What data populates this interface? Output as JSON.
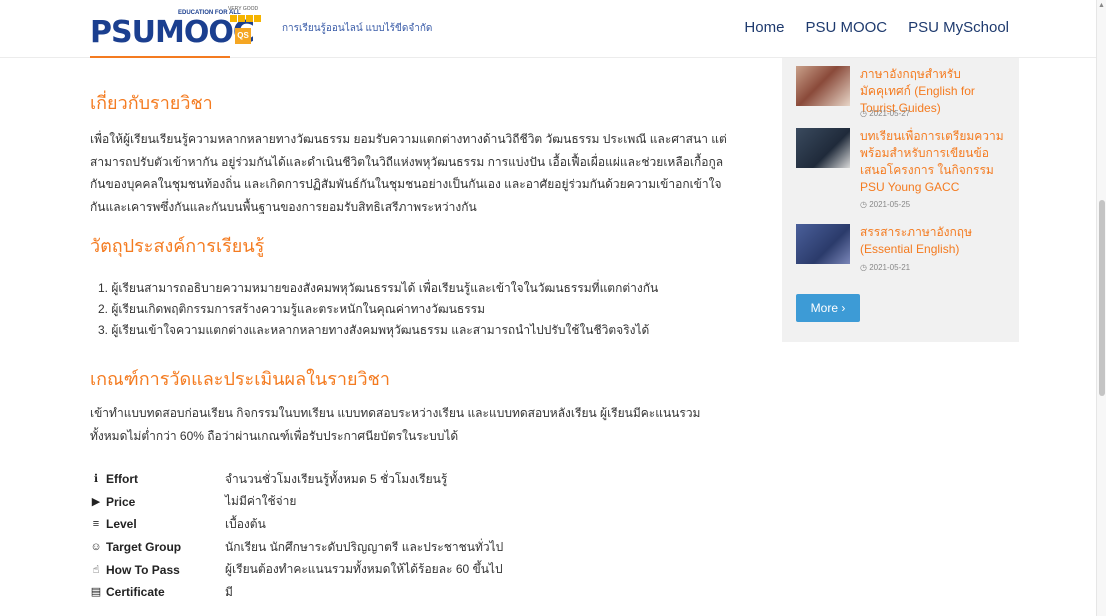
{
  "header": {
    "logo_text_psu": "PSU",
    "logo_text_mooc": "MOOC",
    "logo_tagline_small": "EDUCATION FOR ALL",
    "logo_badge_small": "VERY GOOD",
    "qs_badge": "QS",
    "tagline": "การเรียนรู้ออนไลน์ แบบไร้ขีดจำกัด",
    "nav": [
      {
        "label": "Home"
      },
      {
        "label": "PSU MOOC"
      },
      {
        "label": "PSU MySchool"
      }
    ]
  },
  "about": {
    "title": "เกี่ยวกับรายวิชา",
    "lines": [
      "เพื่อให้ผู้เรียนเรียนรู้ความหลากหลายทางวัฒนธรรม  ยอมรับความแตกต่างทางด้านวิถีชีวิต วัฒนธรรม ประเพณี และศาสนา แต่",
      "สามารถปรับตัวเข้าหากัน อยู่ร่วมกันได้และดำเนินชีวิตในวิถีแห่งพหุวัฒนธรรม การแบ่งปัน เอื้อเฟื้อเผื่อแผ่และช่วยเหลือเกื้อกูล",
      "กันของบุคคลในชุมชนท้องถิ่น และเกิดการปฏิสัมพันธ์กันในชุมชนอย่างเป็นกันเอง และอาศัยอยู่ร่วมกันด้วยความเข้าอกเข้าใจ",
      "กันและเคารพซึ่งกันและกันบนพื้นฐานของการยอมรับสิทธิเสรีภาพระหว่างกัน"
    ]
  },
  "objectives": {
    "title": "วัตถุประสงค์การเรียนรู้",
    "items": [
      "1. ผู้เรียนสามารถอธิบายความหมายของสังคมพหุวัฒนธรรมได้ เพื่อเรียนรู้และเข้าใจในวัฒนธรรมที่แตกต่างกัน",
      "2. ผู้เรียนเกิดพฤติกรรมการสร้างความรู้และตระหนักในคุณค่าทางวัฒนธรรม",
      "3. ผู้เรียนเข้าใจความแตกต่างและหลากหลายทางสังคมพหุวัฒนธรรม และสามารถนำไปปรับใช้ในชีวิตจริงได้"
    ]
  },
  "assessment": {
    "title": "เกณฑ์การวัดและประเมินผลในรายวิชา",
    "lines": [
      "เข้าทำแบบทดสอบก่อนเรียน กิจกรรมในบทเรียน แบบทดสอบระหว่างเรียน และแบบทดสอบหลังเรียน ผู้เรียนมีคะแนนรวม",
      "ทั้งหมดไม่ต่ำกว่า 60% ถือว่าผ่านเกณฑ์เพื่อรับประกาศนียบัตรในระบบได้"
    ]
  },
  "info": [
    {
      "icon": "info-circle-icon",
      "glyph": "ℹ",
      "label": "Effort",
      "value": "จำนวนชั่วโมงเรียนรู้ทั้งหมด 5 ชั่วโมงเรียนรู้"
    },
    {
      "icon": "tag-icon",
      "glyph": "▶",
      "label": "Price",
      "value": "ไม่มีค่าใช้จ่าย"
    },
    {
      "icon": "bars-icon",
      "glyph": "≡",
      "label": "Level",
      "value": "เบื้องต้น"
    },
    {
      "icon": "users-icon",
      "glyph": "☺",
      "label": "Target Group",
      "value": "นักเรียน นักศึกษาระดับปริญญาตรี และประชาชนทั่วไป"
    },
    {
      "icon": "thumbs-up-icon",
      "glyph": "☝",
      "label": "How To Pass",
      "value": "ผู้เรียนต้องทำคะแนนรวมทั้งหมดให้ได้ร้อยละ 60 ขึ้นไป"
    },
    {
      "icon": "certificate-icon",
      "glyph": "▤",
      "label": "Certificate",
      "value": "มี"
    }
  ],
  "sidebar": {
    "items": [
      {
        "title": "ภาษาอังกฤษสำหรับมัคคุเทศก์ (English for Tourist Guides)",
        "date": "◷ 2021-05-27",
        "thumb_color": "#8a4a3a"
      },
      {
        "title": "บทเรียนเพื่อการเตรียมความพร้อมสำหรับการเขียนข้อเสนอโครงการ ในกิจกรรม PSU Young GACC",
        "date": "◷ 2021-05-25",
        "thumb_color": "#1f2a3a"
      },
      {
        "title": "สรรสาระภาษาอังกฤษ (Essential English)",
        "date": "◷ 2021-05-21",
        "thumb_color": "#2b3b6b"
      }
    ],
    "more_label": "More ›"
  },
  "colors": {
    "accent_orange": "#f47b20",
    "brand_blue": "#1b3f8f",
    "button_blue": "#3d9bd6"
  }
}
